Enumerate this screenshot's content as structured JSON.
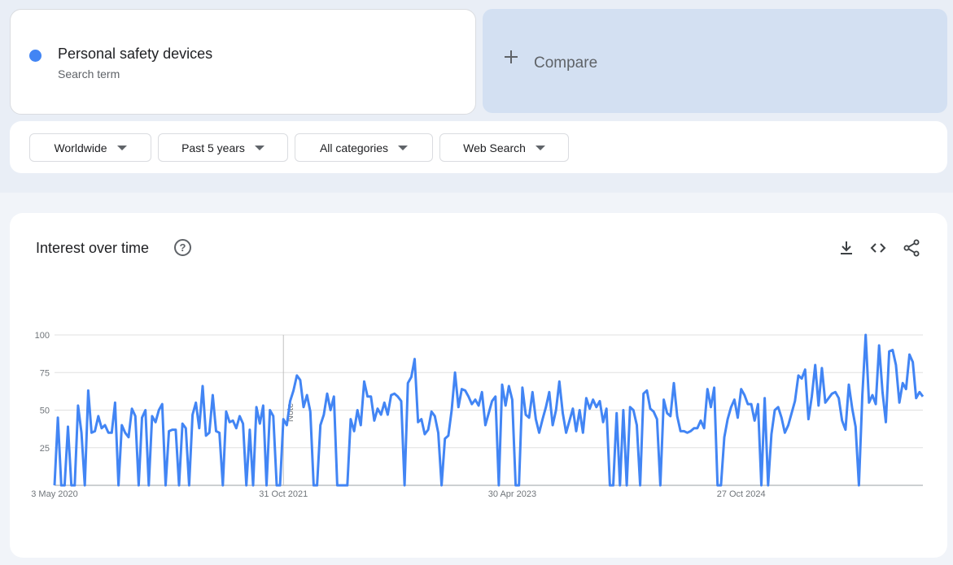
{
  "search_term": {
    "name": "Personal safety devices",
    "type": "Search term",
    "color": "#4285f4"
  },
  "compare": {
    "label": "Compare"
  },
  "filters": [
    {
      "label": "Worldwide"
    },
    {
      "label": "Past 5 years"
    },
    {
      "label": "All categories"
    },
    {
      "label": "Web Search"
    }
  ],
  "chart": {
    "title": "Interest over time",
    "help_icon": "help-circle-icon",
    "note_label": "Note"
  },
  "toolbar": {
    "download_icon": "download-icon",
    "embed_icon": "embed-code-icon",
    "share_icon": "share-icon"
  },
  "chart_data": {
    "type": "line",
    "title": "Interest over time",
    "xlabel": "",
    "ylabel": "",
    "ylim": [
      0,
      100
    ],
    "yticks": [
      25,
      50,
      75,
      100
    ],
    "xtick_labels": [
      "3 May 2020",
      "31 Oct 2021",
      "30 Apr 2023",
      "27 Oct 2024"
    ],
    "grid": true,
    "note_marker_week": 68,
    "series": [
      {
        "name": "Personal safety devices",
        "color": "#4285f4",
        "values": [
          0,
          45,
          0,
          0,
          39,
          0,
          0,
          53,
          35,
          0,
          63,
          35,
          36,
          46,
          38,
          40,
          35,
          35,
          55,
          0,
          40,
          35,
          32,
          51,
          46,
          0,
          45,
          50,
          0,
          46,
          42,
          50,
          54,
          0,
          36,
          37,
          37,
          0,
          41,
          38,
          0,
          47,
          55,
          38,
          66,
          33,
          35,
          60,
          36,
          35,
          0,
          49,
          42,
          43,
          38,
          46,
          41,
          0,
          37,
          0,
          52,
          41,
          53,
          0,
          50,
          46,
          0,
          0,
          44,
          40,
          56,
          63,
          73,
          70,
          52,
          60,
          49,
          0,
          0,
          40,
          47,
          61,
          50,
          59,
          0,
          0,
          0,
          0,
          44,
          36,
          50,
          40,
          69,
          59,
          59,
          43,
          51,
          47,
          55,
          47,
          60,
          61,
          59,
          56,
          0,
          68,
          72,
          84,
          42,
          44,
          34,
          37,
          49,
          46,
          35,
          0,
          31,
          33,
          50,
          75,
          52,
          64,
          63,
          59,
          54,
          57,
          53,
          62,
          40,
          48,
          56,
          59,
          0,
          67,
          53,
          66,
          57,
          0,
          0,
          65,
          47,
          45,
          62,
          44,
          35,
          44,
          52,
          62,
          40,
          50,
          69,
          48,
          35,
          43,
          51,
          36,
          50,
          35,
          58,
          51,
          57,
          52,
          56,
          42,
          51,
          0,
          0,
          48,
          0,
          50,
          0,
          52,
          50,
          40,
          0,
          61,
          63,
          51,
          49,
          44,
          0,
          57,
          48,
          46,
          68,
          46,
          36,
          36,
          35,
          36,
          38,
          38,
          43,
          38,
          64,
          52,
          65,
          0,
          0,
          32,
          44,
          52,
          57,
          45,
          64,
          60,
          54,
          54,
          43,
          54,
          0,
          58,
          0,
          34,
          50,
          52,
          45,
          35,
          40,
          48,
          56,
          73,
          71,
          77,
          44,
          59,
          80,
          53,
          78,
          55,
          58,
          61,
          62,
          58,
          43,
          37,
          67,
          51,
          39,
          0,
          60,
          100,
          55,
          60,
          54,
          93,
          62,
          42,
          89,
          90,
          80,
          55,
          68,
          64,
          87,
          82,
          58,
          62,
          59
        ]
      }
    ]
  }
}
